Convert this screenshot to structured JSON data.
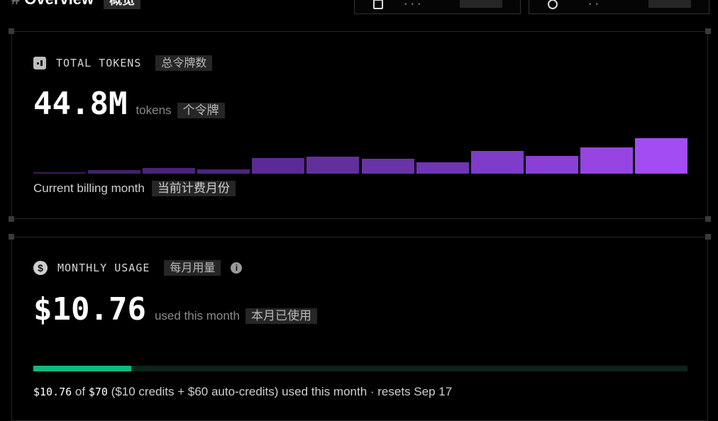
{
  "header": {
    "hash": "#",
    "title": "Overview",
    "title_cn": "概览"
  },
  "tokens_card": {
    "icon": "token-icon",
    "label": "TOTAL TOKENS",
    "label_cn": "总令牌数",
    "value": "44.8M",
    "unit": "tokens",
    "unit_cn": "个令牌",
    "footnote": "Current billing month",
    "footnote_cn": "当前计费月份",
    "chart_data": {
      "type": "bar",
      "series": [
        {
          "values": [
            2,
            5,
            8,
            6,
            22,
            24,
            21,
            16,
            32,
            25,
            37,
            50
          ]
        }
      ],
      "colors": [
        "#3b1a5e",
        "#43206c",
        "#4b237a",
        "#4d2480",
        "#5c2a94",
        "#62309c",
        "#6a33a8",
        "#6f36b4",
        "#7e3cc8",
        "#8a40d6",
        "#9645e2",
        "#a44cf4"
      ]
    }
  },
  "usage_card": {
    "icon": "dollar-icon",
    "label": "MONTHLY USAGE",
    "label_cn": "每月用量",
    "info_icon": "info-icon",
    "value": "$10.76",
    "unit": "used this month",
    "unit_cn": "本月已使用",
    "progress_fraction": 0.15,
    "progress_color": "#10b981",
    "used": "$10.76",
    "of_text": "of",
    "limit": "$70",
    "detail": "($10 credits + $60 auto-credits) used this month · resets Sep 17"
  }
}
